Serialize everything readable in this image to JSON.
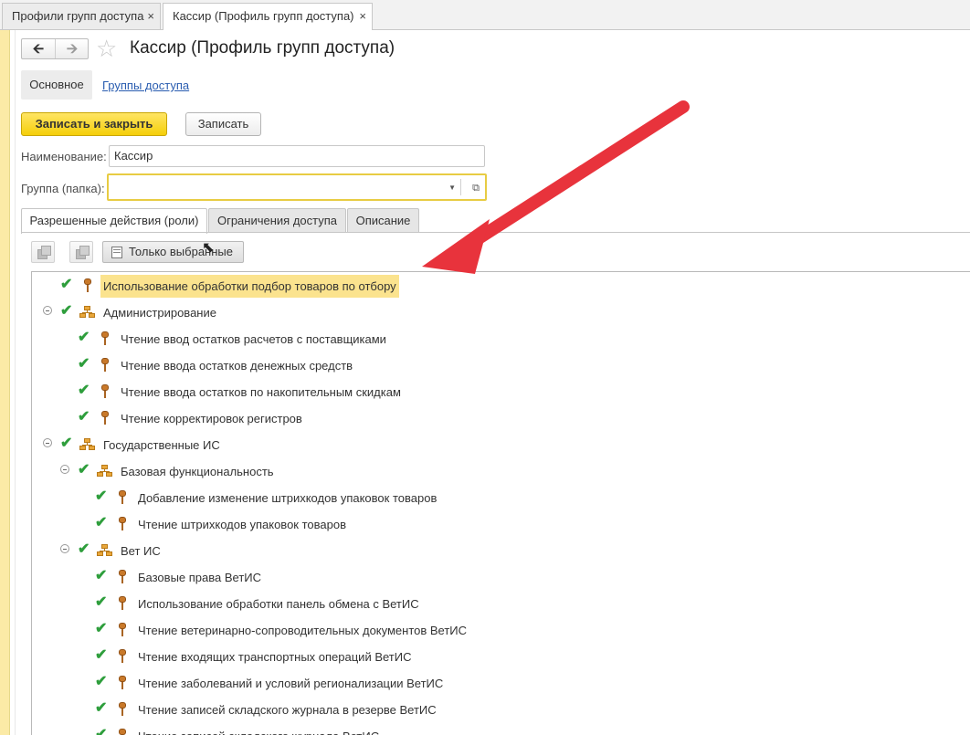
{
  "window_tabs": [
    {
      "label": "Профили групп доступа",
      "close": "×"
    },
    {
      "label": "Кассир (Профиль групп доступа)",
      "close": "×"
    }
  ],
  "header": {
    "title": "Кассир (Профиль групп доступа)"
  },
  "sections": {
    "main": "Основное",
    "link": "Группы доступа"
  },
  "buttons": {
    "save_close": "Записать и закрыть",
    "save": "Записать"
  },
  "form": {
    "name_label": "Наименование:",
    "name_value": "Кассир",
    "group_label": "Группа (папка):",
    "group_value": ""
  },
  "inner_tabs": [
    "Разрешенные действия (роли)",
    "Ограничения доступа",
    "Описание"
  ],
  "toolbar": {
    "only_selected": "Только выбранные"
  },
  "tree": [
    {
      "text": "Использование обработки подбор товаров по отбору",
      "level": 0,
      "kind": "role",
      "highlight": true
    },
    {
      "text": "Администрирование",
      "level": 0,
      "kind": "group",
      "expanded": true
    },
    {
      "text": "Чтение ввод остатков расчетов с поставщиками",
      "level": 1,
      "kind": "role"
    },
    {
      "text": "Чтение ввода остатков денежных средств",
      "level": 1,
      "kind": "role"
    },
    {
      "text": "Чтение ввода остатков по накопительным скидкам",
      "level": 1,
      "kind": "role"
    },
    {
      "text": "Чтение корректировок регистров",
      "level": 1,
      "kind": "role"
    },
    {
      "text": "Государственные ИС",
      "level": 0,
      "kind": "group",
      "expanded": true
    },
    {
      "text": "Базовая функциональность",
      "level": 1,
      "kind": "group",
      "expanded": true
    },
    {
      "text": "Добавление изменение штрихкодов упаковок товаров",
      "level": 2,
      "kind": "role"
    },
    {
      "text": "Чтение штрихкодов упаковок товаров",
      "level": 2,
      "kind": "role"
    },
    {
      "text": "Вет ИС",
      "level": 1,
      "kind": "group",
      "expanded": true
    },
    {
      "text": "Базовые права ВетИС",
      "level": 2,
      "kind": "role"
    },
    {
      "text": "Использование обработки панель обмена с ВетИС",
      "level": 2,
      "kind": "role"
    },
    {
      "text": "Чтение ветеринарно-сопроводительных документов ВетИС",
      "level": 2,
      "kind": "role"
    },
    {
      "text": "Чтение входящих транспортных операций ВетИС",
      "level": 2,
      "kind": "role"
    },
    {
      "text": "Чтение заболеваний и условий регионализации ВетИС",
      "level": 2,
      "kind": "role"
    },
    {
      "text": "Чтение записей складского журнала в резерве ВетИС",
      "level": 2,
      "kind": "role"
    },
    {
      "text": "Чтение записей складского журнала ВетИС",
      "level": 2,
      "kind": "role"
    }
  ],
  "colors": {
    "accent_yellow": "#f5cf0a",
    "highlight": "#fbe38e",
    "check_green": "#2e9e3c",
    "arrow_red": "#e8333c"
  }
}
